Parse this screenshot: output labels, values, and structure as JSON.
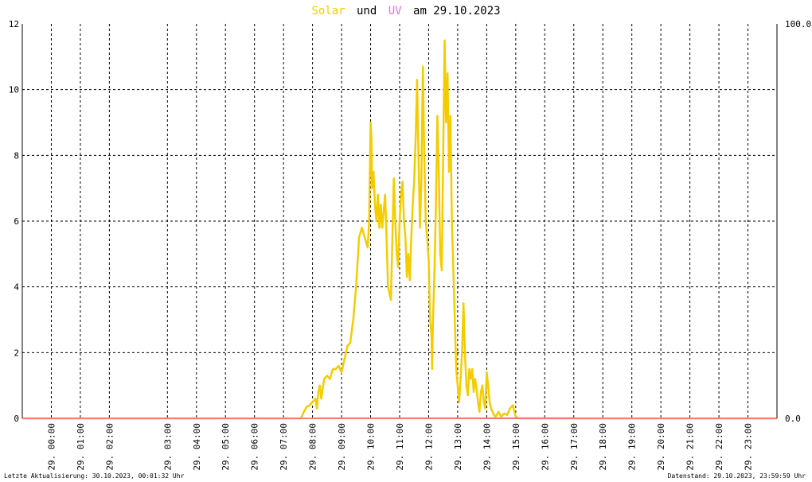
{
  "title": {
    "part1": "Solar",
    "part2": "und",
    "part3": "UV",
    "part4": "am 29.10.2023"
  },
  "colors": {
    "solar": "#f5cc00",
    "uv": "#e070e0",
    "baseline": "#f08070",
    "grid": "#000000",
    "frame": "#000000"
  },
  "footer": {
    "left": "Letzte Aktualisierung: 30.10.2023, 00:01:32 Uhr",
    "right": "Datenstand: 29.10.2023, 23:59:59 Uhr"
  },
  "chart_data": {
    "type": "line",
    "title": "Solar und UV am 29.10.2023",
    "ylim_left": [
      0,
      12
    ],
    "yticks_left": [
      "0",
      "2",
      "4",
      "6",
      "8",
      "10",
      "12"
    ],
    "ylim_right": [
      0,
      100
    ],
    "yticks_right": [
      "0.0",
      "100.0"
    ],
    "xlim_hours": [
      -1,
      25
    ],
    "grid": true,
    "xticks": [
      {
        "h": 0,
        "label": "29. 00:00"
      },
      {
        "h": 1,
        "label": "29. 01:00"
      },
      {
        "h": 2,
        "label": "29. 02:00"
      },
      {
        "h": 4,
        "label": "29. 03:00"
      },
      {
        "h": 5,
        "label": "29. 04:00"
      },
      {
        "h": 6,
        "label": "29. 05:00"
      },
      {
        "h": 7,
        "label": "29. 06:00"
      },
      {
        "h": 8,
        "label": "29. 07:00"
      },
      {
        "h": 9,
        "label": "29. 08:00"
      },
      {
        "h": 10,
        "label": "29. 09:00"
      },
      {
        "h": 11,
        "label": "29. 10:00"
      },
      {
        "h": 12,
        "label": "29. 11:00"
      },
      {
        "h": 13,
        "label": "29. 12:00"
      },
      {
        "h": 14,
        "label": "29. 13:00"
      },
      {
        "h": 15,
        "label": "29. 14:00"
      },
      {
        "h": 16,
        "label": "29. 15:00"
      },
      {
        "h": 17,
        "label": "29. 16:00"
      },
      {
        "h": 18,
        "label": "29. 17:00"
      },
      {
        "h": 19,
        "label": "29. 18:00"
      },
      {
        "h": 20,
        "label": "29. 19:00"
      },
      {
        "h": 21,
        "label": "29. 20:00"
      },
      {
        "h": 22,
        "label": "29. 21:00"
      },
      {
        "h": 23,
        "label": "29. 22:00"
      },
      {
        "h": 24,
        "label": "29. 23:00"
      }
    ],
    "series": [
      {
        "name": "Solar",
        "x": [
          -1,
          8.6,
          8.7,
          8.8,
          8.9,
          9.0,
          9.1,
          9.15,
          9.2,
          9.25,
          9.3,
          9.4,
          9.5,
          9.6,
          9.7,
          9.8,
          9.9,
          10.0,
          10.1,
          10.2,
          10.3,
          10.4,
          10.5,
          10.6,
          10.7,
          10.8,
          10.9,
          10.95,
          11.0,
          11.03,
          11.05,
          11.1,
          11.15,
          11.2,
          11.25,
          11.3,
          11.35,
          11.4,
          11.5,
          11.55,
          11.6,
          11.7,
          11.75,
          11.8,
          11.85,
          11.9,
          11.95,
          12.0,
          12.05,
          12.1,
          12.15,
          12.2,
          12.25,
          12.3,
          12.35,
          12.4,
          12.45,
          12.5,
          12.55,
          12.6,
          12.65,
          12.7,
          12.75,
          12.8,
          12.85,
          12.9,
          12.95,
          13.0,
          13.05,
          13.1,
          13.12,
          13.15,
          13.2,
          13.25,
          13.3,
          13.35,
          13.4,
          13.45,
          13.5,
          13.55,
          13.6,
          13.65,
          13.7,
          13.75,
          13.8,
          13.85,
          13.9,
          13.95,
          14.0,
          14.05,
          14.1,
          14.15,
          14.2,
          14.25,
          14.3,
          14.35,
          14.4,
          14.45,
          14.5,
          14.55,
          14.6,
          14.65,
          14.7,
          14.75,
          14.8,
          14.85,
          14.9,
          14.95,
          15.0,
          15.05,
          15.1,
          15.15,
          15.2,
          15.25,
          15.3,
          15.35,
          15.4,
          15.5,
          15.6,
          15.7,
          15.8,
          15.9,
          16.0,
          16.1,
          16.2,
          16.3,
          16.4,
          16.5,
          16.6,
          16.7,
          16.8,
          16.9,
          17.0,
          17.1,
          17.2,
          17.25,
          17.3,
          25
        ],
        "values": [
          0,
          0,
          0.2,
          0.35,
          0.4,
          0.5,
          0.6,
          0.3,
          0.8,
          1.0,
          0.6,
          1.2,
          1.3,
          1.2,
          1.5,
          1.5,
          1.6,
          1.4,
          1.8,
          2.2,
          2.3,
          3.0,
          4.0,
          5.5,
          5.8,
          5.5,
          5.2,
          6.0,
          9.0,
          8.5,
          7.0,
          7.5,
          6.5,
          6.0,
          6.8,
          5.8,
          6.5,
          5.8,
          6.8,
          5.5,
          4.0,
          3.6,
          5.5,
          7.3,
          6.0,
          5.0,
          4.6,
          6.0,
          6.8,
          7.2,
          6.0,
          5.5,
          4.3,
          5.0,
          4.2,
          5.5,
          6.5,
          7.2,
          8.5,
          10.3,
          8.0,
          5.8,
          7.2,
          10.7,
          8.0,
          6.0,
          5.5,
          4.8,
          3.0,
          2.5,
          1.5,
          3.0,
          4.5,
          6.5,
          9.2,
          7.5,
          5.0,
          4.5,
          8.0,
          11.5,
          9.0,
          10.5,
          7.5,
          9.2,
          6.0,
          4.5,
          3.0,
          1.5,
          1.0,
          0.5,
          1.2,
          2.0,
          3.5,
          2.0,
          1.0,
          0.7,
          1.5,
          1.2,
          1.5,
          0.8,
          1.2,
          0.9,
          0.5,
          0.2,
          0.8,
          1.0,
          0.5,
          0.3,
          1.4,
          1.0,
          0.5,
          0.3,
          0.2,
          0.1,
          0.05,
          0.1,
          0.2,
          0.05,
          0.15,
          0.1,
          0.3,
          0.4,
          0.05,
          0.0,
          0.0,
          0.0,
          0.0,
          0.0,
          0.0,
          0.0,
          0.0,
          0.0,
          0.0,
          0.0,
          0.0,
          0.0,
          0.0,
          0.0
        ]
      },
      {
        "name": "UV",
        "x": [
          -1,
          25
        ],
        "values": [
          0,
          0
        ]
      }
    ]
  }
}
